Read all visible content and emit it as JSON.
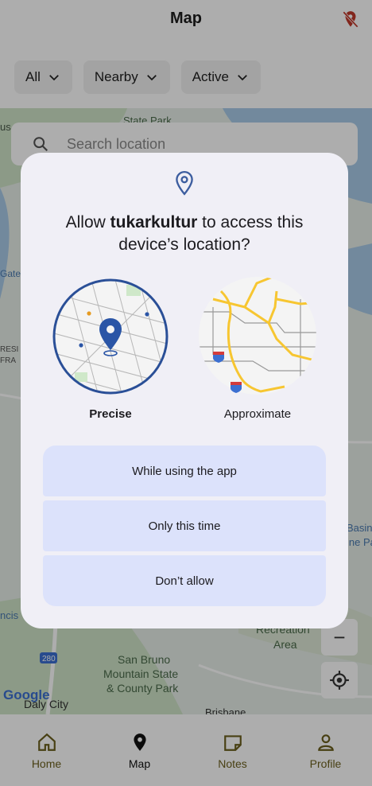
{
  "app": {
    "title": "Map",
    "location_icon": "location-off-icon"
  },
  "filters": [
    {
      "label": "All"
    },
    {
      "label": "Nearby"
    },
    {
      "label": "Active"
    }
  ],
  "search": {
    "placeholder": "Search location"
  },
  "map": {
    "labels": [
      "State Park",
      "Gate",
      "RESI",
      "FRA",
      "Basin",
      "ine Pa",
      "ncis",
      "Recreation",
      "Area",
      "San Bruno",
      "Mountain State",
      "& County Park",
      "Daly City",
      "Brisbane",
      "280",
      "us"
    ],
    "attribution": "Google",
    "zoom_out_label": "−"
  },
  "dialog": {
    "title_prefix": "Allow ",
    "app_name": "tukarkultur",
    "title_suffix": " to access this device’s location?",
    "options": [
      {
        "label": "Precise",
        "selected": true
      },
      {
        "label": "Approximate",
        "selected": false
      }
    ],
    "buttons": [
      {
        "label": "While using the app"
      },
      {
        "label": "Only this time"
      },
      {
        "label": "Don’t allow"
      }
    ]
  },
  "bottom_nav": [
    {
      "label": "Home",
      "icon": "home-icon",
      "active": false
    },
    {
      "label": "Map",
      "icon": "map-pin-icon",
      "active": true
    },
    {
      "label": "Notes",
      "icon": "notes-icon",
      "active": false
    },
    {
      "label": "Profile",
      "icon": "profile-icon",
      "active": false
    }
  ],
  "colors": {
    "accent_nav": "#6b5f1c",
    "dialog_bg": "#f0eff6",
    "button_bg": "#dce2fb",
    "pin_blue": "#2a55a6",
    "map_road": "#f7c631"
  }
}
